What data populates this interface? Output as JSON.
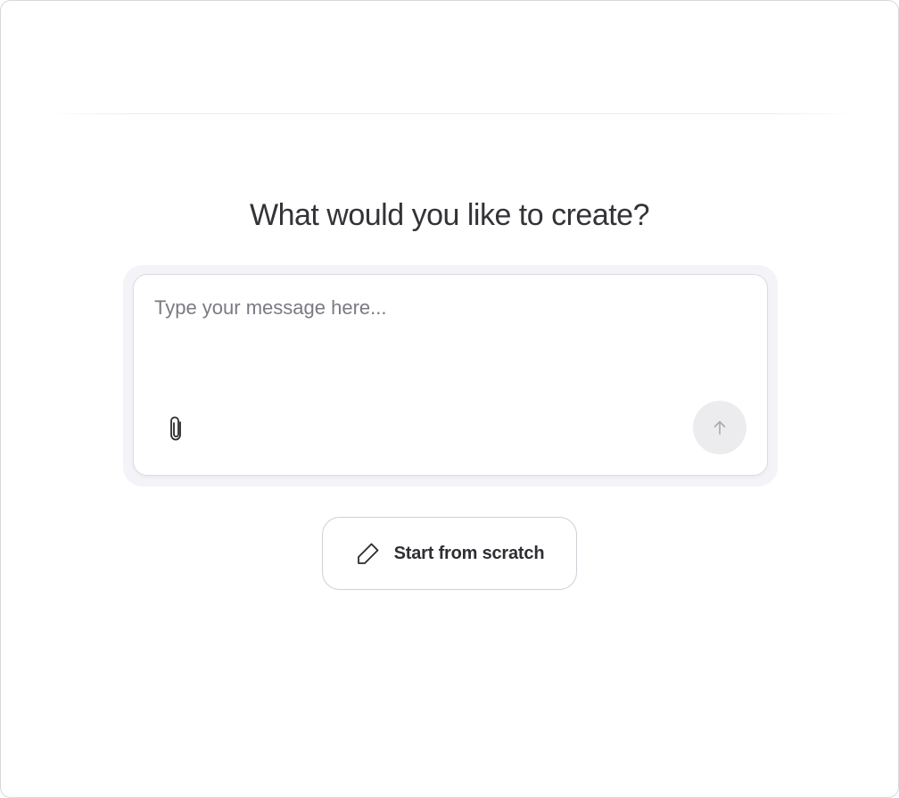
{
  "main": {
    "heading": "What would you like to create?"
  },
  "composer": {
    "placeholder": "Type your message here...",
    "value": "",
    "attach_icon": "paperclip-icon",
    "send_icon": "arrow-up-icon"
  },
  "actions": {
    "start_from_scratch_label": "Start from scratch",
    "start_from_scratch_icon": "pencil-icon"
  },
  "colors": {
    "heading": "#333338",
    "placeholder": "#7a7a82",
    "send_button_bg": "#ececef",
    "border": "#dcdce2"
  }
}
